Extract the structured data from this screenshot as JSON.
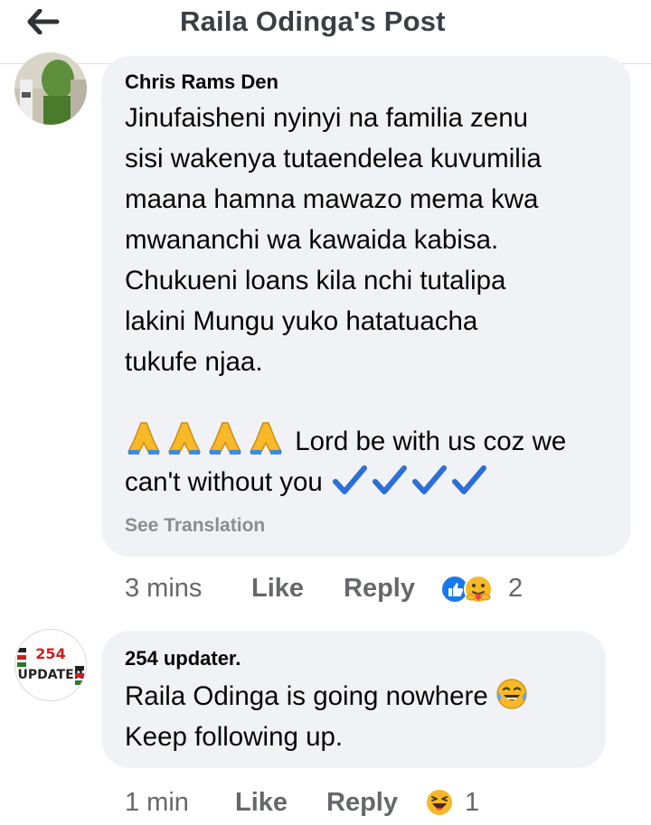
{
  "header": {
    "title": "Raila Odinga's Post"
  },
  "comments": [
    {
      "author": "Chris Rams Den",
      "text_main": "Jinufaisheni nyinyi na familia zenu\nsisi wakenya tutaendelea kuvumilia\nmaana hamna mawazo mema kwa\nmwananchi wa kawaida kabisa.\nChukueni loans kila nchi tutalipa\nlakini Mungu yuko hatatuacha\ntukufe njaa.",
      "text_line1": "Lord be with us coz we",
      "text_line2": "can't without you",
      "see_translation": "See Translation",
      "time": "3 mins",
      "like": "Like",
      "reply": "Reply",
      "reaction_count": "2",
      "reactions": [
        "like-reaction",
        "care-reaction"
      ]
    },
    {
      "author": "254 updater.",
      "text_line1": "Raila Odinga is going nowhere",
      "text_line2": "Keep following up.",
      "time": "1 min",
      "like": "Like",
      "reply": "Reply",
      "reaction_count": "1",
      "reactions": [
        "haha-reaction"
      ]
    }
  ],
  "colors": {
    "bubble": "#f0f2f5",
    "meta_text": "#65676b",
    "like_blue": "#1877f2",
    "check_blue": "#2c6fd6",
    "emoji_yellow": "#f7b928"
  }
}
